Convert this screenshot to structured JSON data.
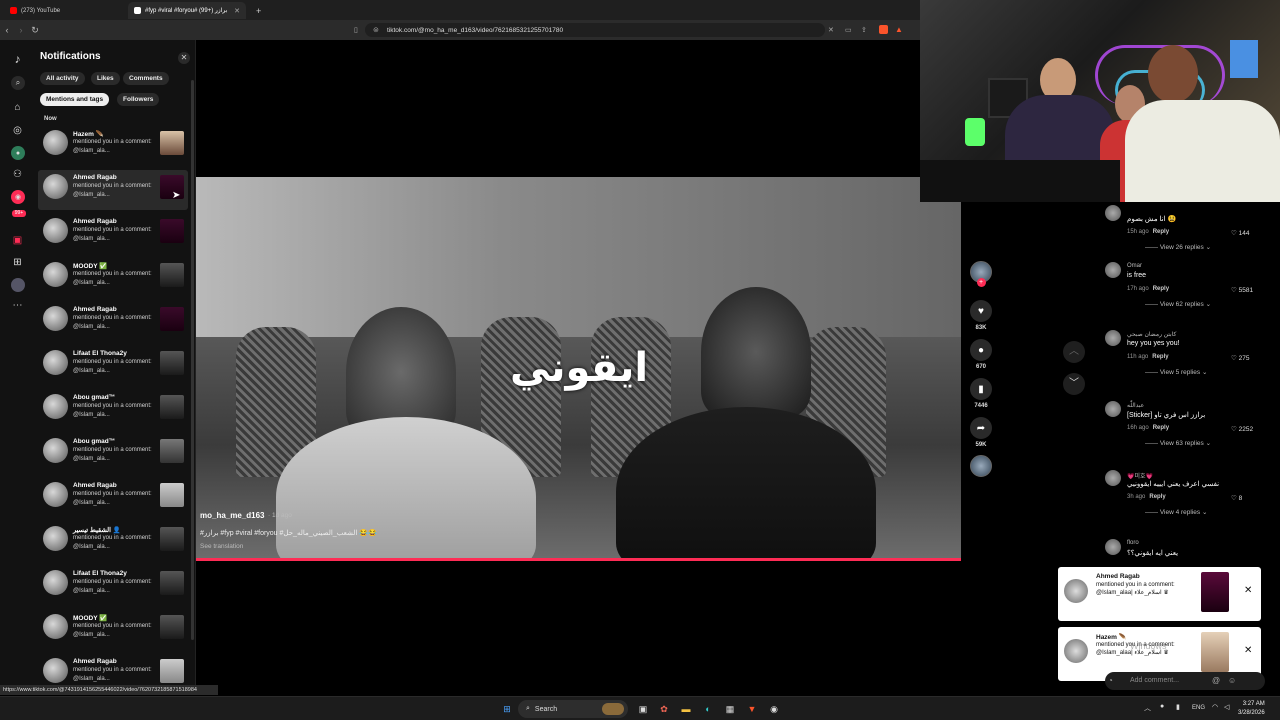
{
  "browser": {
    "tabs": [
      {
        "label": "(273) YouTube",
        "color": "#ff0000"
      },
      {
        "label": "#fyp #viral #foryou# برازر (+99)",
        "color": "#ffffff"
      }
    ],
    "new_tab": "+",
    "url": "tiktok.com/@mo_ha_me_d163/video/7621685321255701780"
  },
  "notifications": {
    "title": "Notifications",
    "filters": [
      "All activity",
      "Likes",
      "Comments",
      "Mentions and tags",
      "Followers"
    ],
    "selected_filter": "Mentions and tags",
    "section": "Now",
    "items": [
      {
        "name": "Hazem 🪶",
        "text": "mentioned you in a comment: @Islam_ala...",
        "thumb": "portrait"
      },
      {
        "name": "Ahmed Ragab",
        "text": "mentioned you in a comment: @Islam_ala...",
        "thumb": "purple"
      },
      {
        "name": "Ahmed Ragab",
        "text": "mentioned you in a comment: @Islam_ala...",
        "thumb": "purple"
      },
      {
        "name": "MOODY ✅",
        "text": "mentioned you in a comment: @Islam_ala...",
        "thumb": "dark"
      },
      {
        "name": "Ahmed Ragab",
        "text": "mentioned you in a comment: @Islam_ala...",
        "thumb": "purple"
      },
      {
        "name": "Lifaat El Thona2y",
        "text": "mentioned you in a comment: @Islam_ala...",
        "thumb": "dark"
      },
      {
        "name": "Abou gmad™",
        "text": "mentioned you in a comment: @Islam_ala...",
        "thumb": "dark"
      },
      {
        "name": "Abou gmad™",
        "text": "mentioned you in a comment: @Islam_ala...",
        "thumb": "gray"
      },
      {
        "name": "Ahmed Ragab",
        "text": "mentioned you in a comment: @Islam_ala...",
        "thumb": "white"
      },
      {
        "name": "الشقيط تيسير 👤",
        "text": "mentioned you in a comment: @Islam_ala...",
        "thumb": "dark"
      },
      {
        "name": "Lifaat El Thona2y",
        "text": "mentioned you in a comment: @Islam_ala...",
        "thumb": "dark"
      },
      {
        "name": "MOODY ✅",
        "text": "mentioned you in a comment: @Islam_ala...",
        "thumb": "dark"
      },
      {
        "name": "Ahmed Ragab",
        "text": "mentioned you in a comment: @Islam_ala...",
        "thumb": "white"
      }
    ]
  },
  "video": {
    "caption": "ايقوني",
    "author": "mo_ha_me_d163",
    "time_ago": "· 1d ago",
    "description": "#برازر #fyp #viral #foryou #الشعب_الصيني_ماله_حل 😂😂",
    "see_translation": "See translation",
    "actions": {
      "likes": "83K",
      "comments": "670",
      "saves": "7446",
      "shares": "59K"
    }
  },
  "comments": [
    {
      "name": "",
      "text": "انا مش بصوم 😫",
      "time": "15h ago",
      "reply": "Reply",
      "likes": "144",
      "view": "View 26 replies"
    },
    {
      "name": "Omar",
      "text": "is free",
      "time": "17h ago",
      "reply": "Reply",
      "likes": "5581",
      "view": "View 62 replies"
    },
    {
      "name": "كابتن رمضان صبحي",
      "text": "hey you yes you!",
      "time": "11h ago",
      "reply": "Reply",
      "likes": "275",
      "view": "View 5 replies"
    },
    {
      "name": "عبداللّٰه",
      "text": "[Sticker] برازز اس فري تاو",
      "time": "16h ago",
      "reply": "Reply",
      "likes": "2252",
      "view": "View 63 replies"
    },
    {
      "name": "💗미호💗",
      "text": "نفسي اعرف يعني ايييه ايقوونيي",
      "time": "3h ago",
      "reply": "Reply",
      "likes": "8",
      "view": "View 4 replies"
    },
    {
      "name": "floro",
      "text": "يعني ايه ايقوني؟؟",
      "time": "",
      "reply": "",
      "likes": "",
      "view": ""
    }
  ],
  "add_comment": "Add comment...",
  "toasts": [
    {
      "name": "Ahmed Ragab",
      "msg": "mentioned you in a comment: @Islam_alaa| اسلام_علاء ♛"
    },
    {
      "name": "Hazem 🪶",
      "msg": "mentioned you in a comment: @Islam_alaa| اسلام_علاء ♛"
    }
  ],
  "watermark": "Windows",
  "status_url": "https://www.tiktok.com/@7431914156255446022/video/7620732185871518984",
  "taskbar": {
    "search": "Search",
    "lang": "ENG",
    "time": "3:27 AM",
    "date": "3/28/2026"
  },
  "colors": {
    "accent": "#fe2c55",
    "bg": "#000000",
    "panel": "#121212"
  }
}
